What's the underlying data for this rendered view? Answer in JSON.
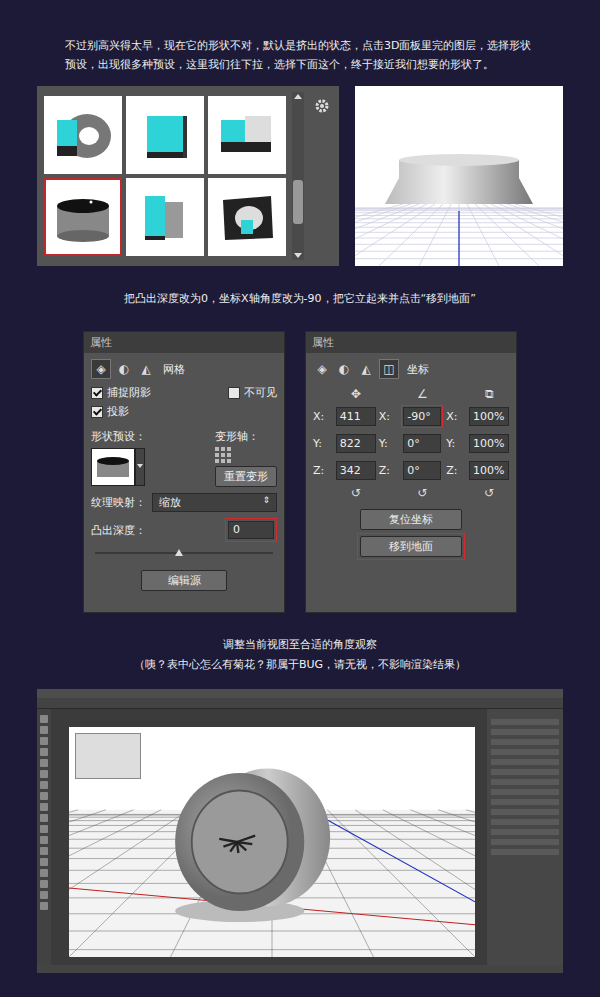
{
  "intro": "不过别高兴得太早，现在它的形状不对，默认是挤出的状态，点击3D面板里完的图层，选择形状预设，出现很多种预设，这里我们往下拉，选择下面这个，终于接近我们想要的形状了。",
  "presets": {
    "tiles": [
      {
        "selected": false
      },
      {
        "selected": false
      },
      {
        "selected": false
      },
      {
        "selected": true
      },
      {
        "selected": false
      },
      {
        "selected": false
      }
    ],
    "scroll_level": 0.75
  },
  "step2": "把凸出深度改为0，坐标X轴角度改为-90，把它立起来并点击“移到地面”",
  "mesh_panel": {
    "title": "属性",
    "tab": "网格",
    "checkboxes": [
      {
        "label": "捕捉阴影",
        "checked": true
      },
      {
        "label": "不可见",
        "checked": false
      },
      {
        "label": "投影",
        "checked": true
      }
    ],
    "shape_preset_label": "形状预设：",
    "deform_axis_label": "变形轴：",
    "reset_button": "重置变形",
    "texture_label": "纹理映射：",
    "texture_value": "缩放",
    "depth_label": "凸出深度：",
    "depth_value": "0",
    "depth_highlighted": true,
    "depth_level": 0.45,
    "edit_button": "编辑源"
  },
  "coord_panel": {
    "title": "属性",
    "tab": "坐标",
    "rows": [
      {
        "label": "X:",
        "position": "411",
        "rotation_label": "X:",
        "rotation": "-90°",
        "rotation_highlighted": true,
        "scale_label": "X:",
        "scale": "100%"
      },
      {
        "label": "Y:",
        "position": "822",
        "rotation_label": "Y:",
        "rotation": "0°",
        "rotation_highlighted": false,
        "scale_label": "Y:",
        "scale": "100%"
      },
      {
        "label": "Z:",
        "position": "342",
        "rotation_label": "Z:",
        "rotation": "0°",
        "rotation_highlighted": false,
        "scale_label": "Z:",
        "scale": "100%"
      }
    ],
    "buttons": [
      {
        "label": "复位坐标",
        "highlighted": false
      },
      {
        "label": "移到地面",
        "highlighted": true
      }
    ]
  },
  "step3": [
    "调整当前视图至合适的角度观察",
    "（咦？表中心怎么有菊花？那属于BUG，请无视，不影响渲染结果）"
  ]
}
